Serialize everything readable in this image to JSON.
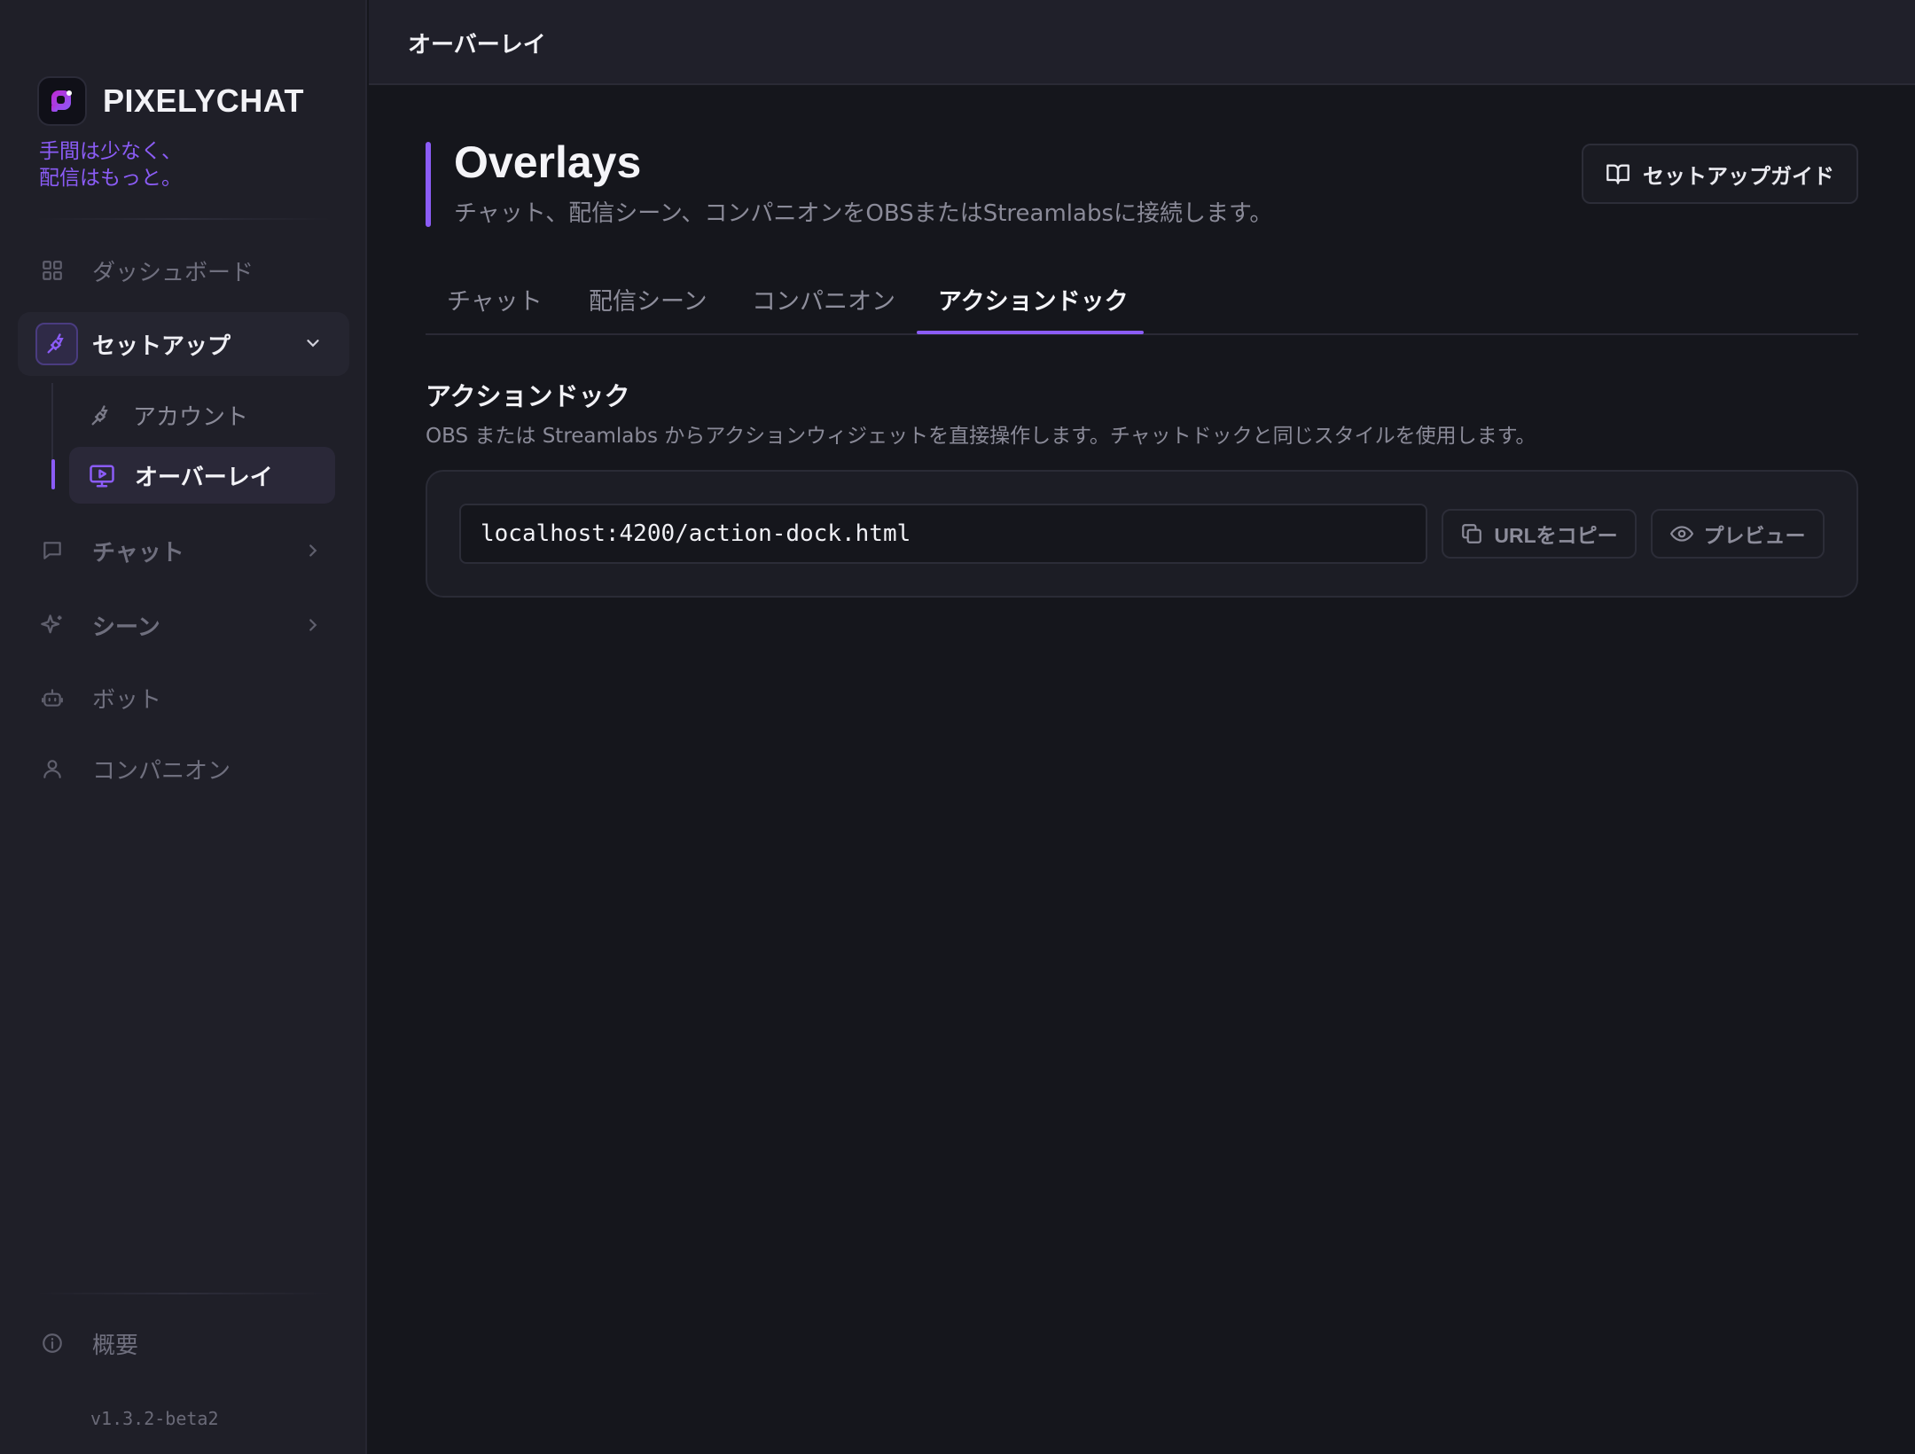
{
  "app": {
    "name": "PIXELYCHAT",
    "tagline_line1": "手間は少なく、",
    "tagline_line2": "配信はもっと。",
    "version": "v1.3.2-beta2",
    "accent_color": "#8b5cf6"
  },
  "sidebar": {
    "items": [
      {
        "label": "ダッシュボード",
        "icon": "grid-icon"
      },
      {
        "label": "セットアップ",
        "icon": "plug-icon",
        "expanded": true
      },
      {
        "label": "チャット",
        "icon": "chat-bubble-icon"
      },
      {
        "label": "シーン",
        "icon": "sparkle-icon"
      },
      {
        "label": "ボット",
        "icon": "robot-icon"
      },
      {
        "label": "コンパニオン",
        "icon": "user-icon"
      }
    ],
    "setup_children": [
      {
        "label": "アカウント",
        "icon": "plug-icon"
      },
      {
        "label": "オーバーレイ",
        "icon": "monitor-play-icon",
        "active": true
      }
    ],
    "footer_item": {
      "label": "概要",
      "icon": "info-icon"
    }
  },
  "header": {
    "title": "オーバーレイ"
  },
  "page": {
    "title": "Overlays",
    "subtitle": "チャット、配信シーン、コンパニオンをOBSまたはStreamlabsに接続します。",
    "guide_button": "セットアップガイド",
    "tabs": [
      {
        "label": "チャット"
      },
      {
        "label": "配信シーン"
      },
      {
        "label": "コンパニオン"
      },
      {
        "label": "アクションドック",
        "active": true
      }
    ]
  },
  "section": {
    "title": "アクションドック",
    "description": "OBS または Streamlabs からアクションウィジェットを直接操作します。チャットドックと同じスタイルを使用します。",
    "url_value": "localhost:4200/action-dock.html",
    "copy_button": "URLをコピー",
    "preview_button": "プレビュー"
  }
}
